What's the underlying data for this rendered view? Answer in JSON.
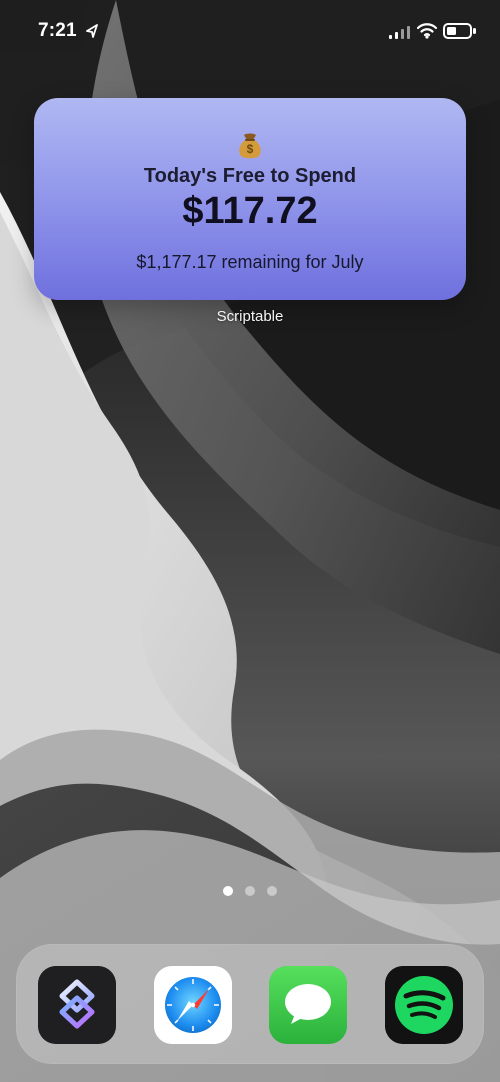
{
  "status_bar": {
    "time": "7:21",
    "icons": [
      "location-arrow-icon",
      "cellular-signal-icon",
      "wifi-icon",
      "battery-icon"
    ]
  },
  "widget": {
    "emoji": "💰",
    "title": "Today's Free to Spend",
    "amount": "$117.72",
    "remaining": "$1,177.17 remaining for July",
    "label": "Scriptable",
    "gradient": [
      "#b0b8f2",
      "#8f94ea",
      "#6f70de"
    ]
  },
  "home": {
    "page_dots": [
      {
        "active": true
      },
      {
        "active": false
      },
      {
        "active": false
      }
    ]
  },
  "dock": {
    "apps": [
      {
        "name": "Shortcuts",
        "icon": "shortcuts-icon"
      },
      {
        "name": "Safari",
        "icon": "safari-icon"
      },
      {
        "name": "Messages",
        "icon": "messages-icon"
      },
      {
        "name": "Spotify",
        "icon": "spotify-icon"
      }
    ]
  },
  "colors": {
    "wallpaper_dark": "#1a1a1a",
    "wallpaper_light": "#cfcfcf",
    "dock": "#ffffff"
  }
}
